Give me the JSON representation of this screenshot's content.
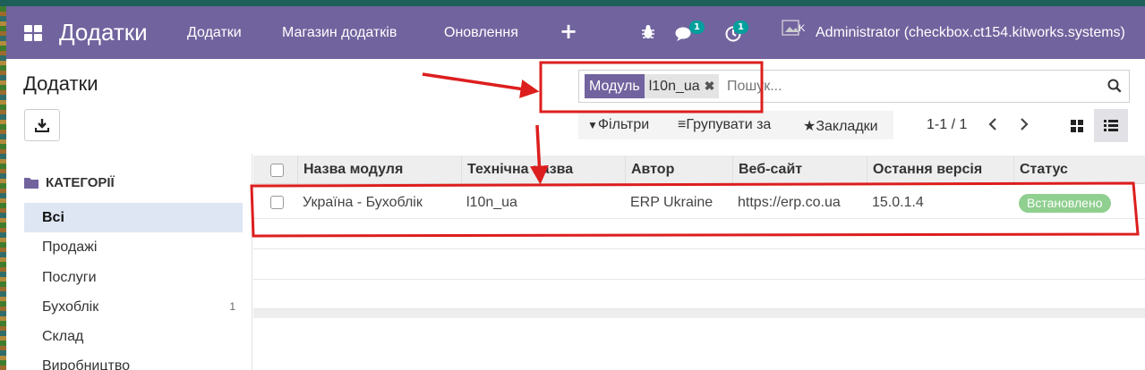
{
  "navbar": {
    "brand": "Додатки",
    "menu": [
      "Додатки",
      "Магазин додатків",
      "Оновлення"
    ],
    "plus": "+",
    "messages_count": "1",
    "activities_count": "1",
    "avatar_alt": "K",
    "user": "Administrator (checkbox.ct154.kitworks.systems)"
  },
  "control_panel": {
    "title": "Додатки",
    "search": {
      "facet_label": "Модуль",
      "facet_value": "l10n_ua",
      "placeholder": "Пошук..."
    },
    "filters": "Фільтри",
    "group_by": "Групувати за",
    "favorites": "Закладки",
    "pager": "1-1 / 1"
  },
  "sidebar": {
    "heading": "КАТЕГОРІЇ",
    "items": [
      {
        "label": "Всі",
        "count": ""
      },
      {
        "label": "Продажі",
        "count": ""
      },
      {
        "label": "Послуги",
        "count": ""
      },
      {
        "label": "Бухоблік",
        "count": "1"
      },
      {
        "label": "Склад",
        "count": ""
      },
      {
        "label": "Виробництво",
        "count": ""
      }
    ]
  },
  "table": {
    "columns": [
      "Назва модуля",
      "Технічна назва",
      "Автор",
      "Веб-сайт",
      "Остання версія",
      "Статус"
    ],
    "rows": [
      {
        "name": "Україна - Бухоблік",
        "technical": "l10n_ua",
        "author": "ERP Ukraine",
        "website": "https://erp.co.ua",
        "version": "15.0.1.4",
        "status": "Встановлено"
      }
    ]
  },
  "colors": {
    "navbar": "#71639e",
    "status_installed": "#8fcf8f",
    "annotation": "#dd1e1e",
    "active_category": "#dee6f3"
  }
}
